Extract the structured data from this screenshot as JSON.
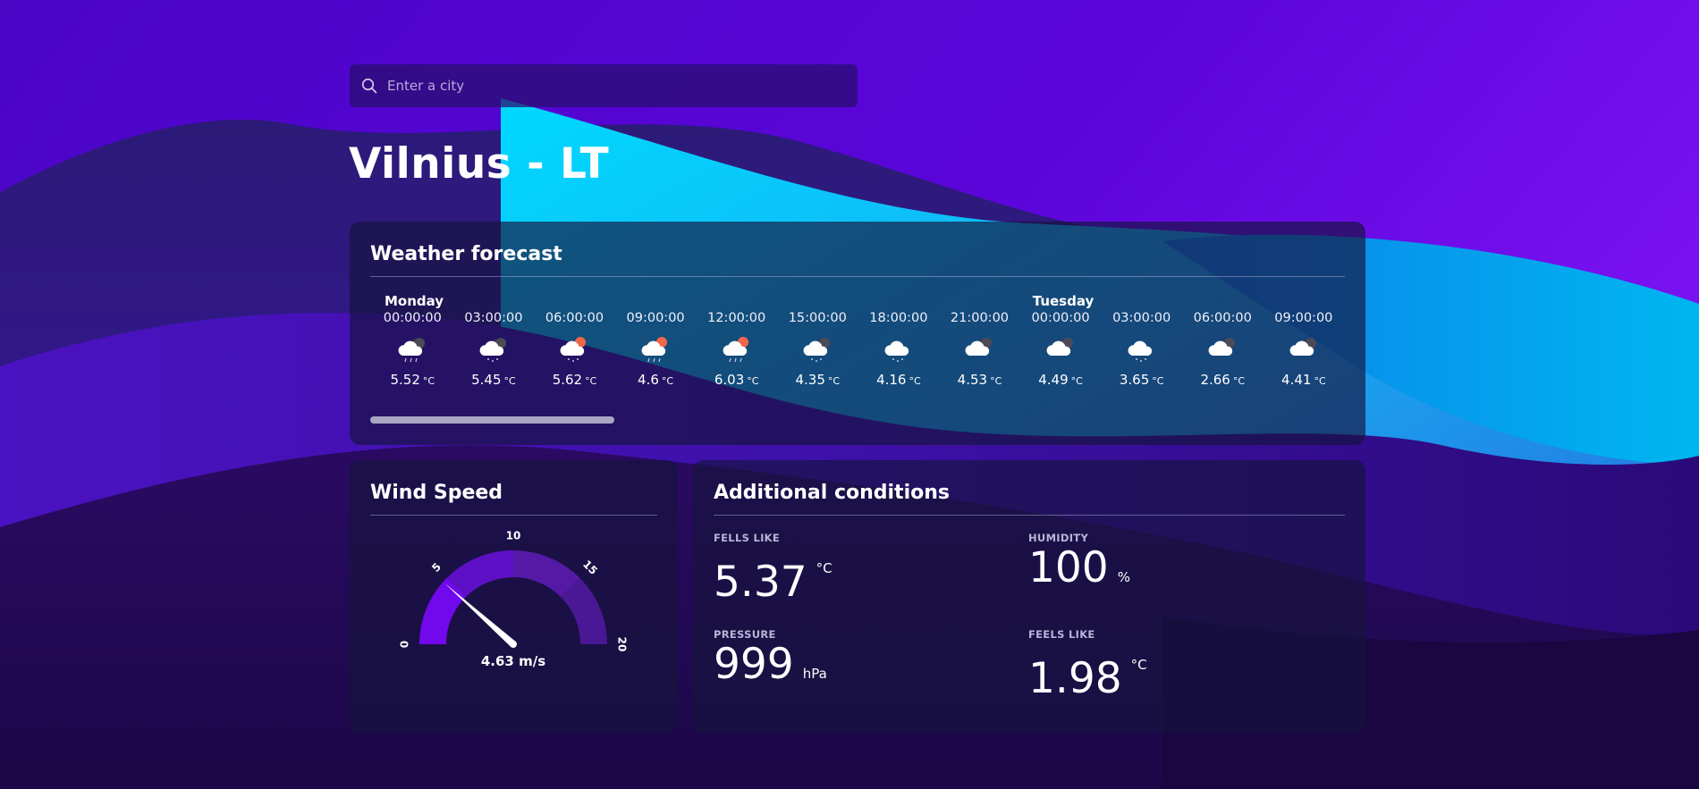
{
  "search": {
    "placeholder": "Enter a city"
  },
  "location": {
    "title": "Vilnius - LT"
  },
  "forecast": {
    "title": "Weather forecast",
    "scroll_fraction": 0.25,
    "slots": [
      {
        "day": "Monday",
        "time": "00:00:00",
        "icon": "cloud-night-rain-icon",
        "temp": "5.52",
        "unit": "°C"
      },
      {
        "day": "",
        "time": "03:00:00",
        "icon": "cloud-night-snow-icon",
        "temp": "5.45",
        "unit": "°C"
      },
      {
        "day": "",
        "time": "06:00:00",
        "icon": "cloud-sun-snow-icon",
        "temp": "5.62",
        "unit": "°C"
      },
      {
        "day": "",
        "time": "09:00:00",
        "icon": "cloud-sun-rain-icon",
        "temp": "4.6",
        "unit": "°C"
      },
      {
        "day": "",
        "time": "12:00:00",
        "icon": "cloud-sun-rain-icon",
        "temp": "6.03",
        "unit": "°C"
      },
      {
        "day": "",
        "time": "15:00:00",
        "icon": "cloud-night-snow-icon",
        "temp": "4.35",
        "unit": "°C"
      },
      {
        "day": "",
        "time": "18:00:00",
        "icon": "cloud-snow-icon",
        "temp": "4.16",
        "unit": "°C"
      },
      {
        "day": "",
        "time": "21:00:00",
        "icon": "cloud-night-icon",
        "temp": "4.53",
        "unit": "°C"
      },
      {
        "day": "Tuesday",
        "time": "00:00:00",
        "icon": "cloud-night-icon",
        "temp": "4.49",
        "unit": "°C"
      },
      {
        "day": "",
        "time": "03:00:00",
        "icon": "cloud-snow-icon",
        "temp": "3.65",
        "unit": "°C"
      },
      {
        "day": "",
        "time": "06:00:00",
        "icon": "cloud-night-icon",
        "temp": "2.66",
        "unit": "°C"
      },
      {
        "day": "",
        "time": "09:00:00",
        "icon": "cloud-night-icon",
        "temp": "4.41",
        "unit": "°C"
      }
    ]
  },
  "wind": {
    "title": "Wind Speed",
    "value": 4.63,
    "label": "4.63 m/s",
    "min": 0,
    "max": 20,
    "ticks": [
      "0",
      "5",
      "10",
      "15",
      "20"
    ]
  },
  "conditions": {
    "title": "Additional conditions",
    "feels_like_1": {
      "label": "FELLS LIKE",
      "value": "5.37",
      "unit": "°C"
    },
    "humidity": {
      "label": "HUMIDITY",
      "value": "100",
      "unit": "%"
    },
    "pressure": {
      "label": "PRESSURE",
      "value": "999",
      "unit": "hPa"
    },
    "feels_like_2": {
      "label": "FEELS LIKE",
      "value": "1.98",
      "unit": "°C"
    }
  },
  "colors": {
    "background": "#5a06d6",
    "wave_cyan": "#00c8ff",
    "wave_dark": "#1a0a4a",
    "card": "#1b1640",
    "gauge_fill": "#7410ec",
    "gauge_track": "#4a1795",
    "scroll_thumb": "#a9a6c4"
  }
}
